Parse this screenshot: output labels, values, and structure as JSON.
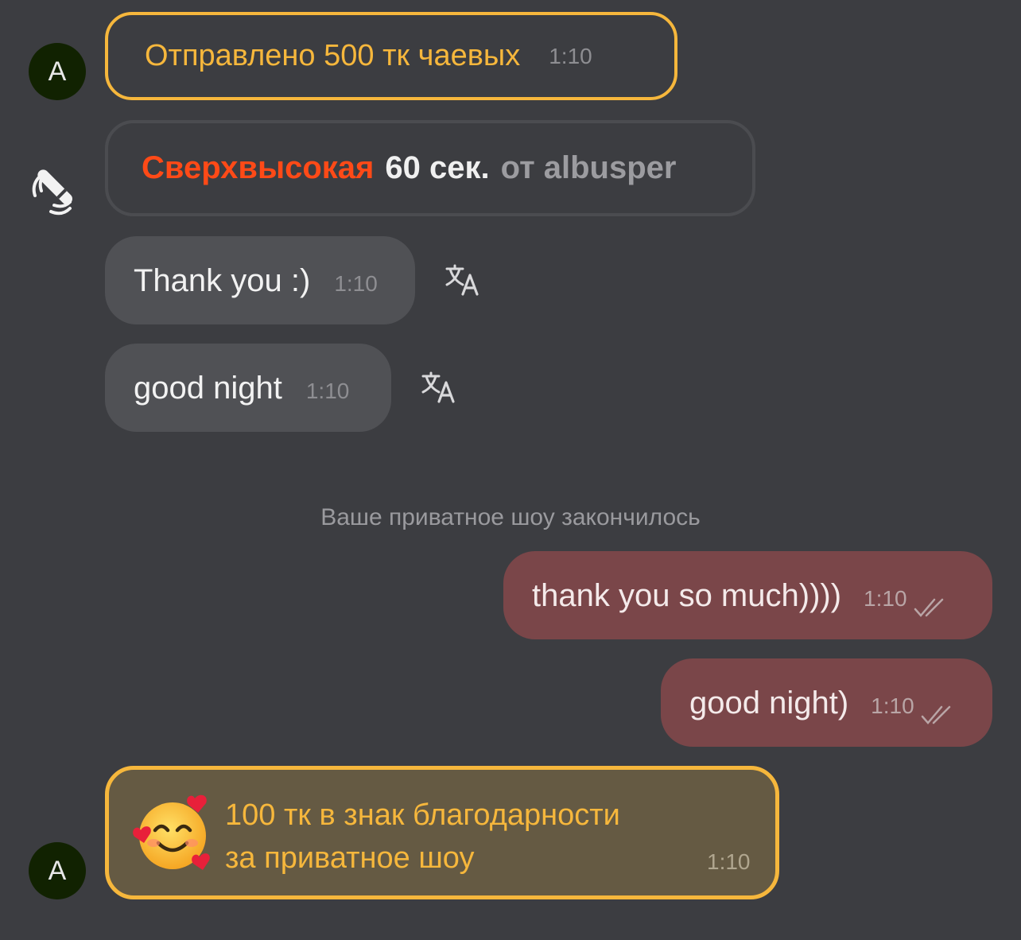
{
  "tip_message": {
    "avatar_letter": "A",
    "text": "Отправлено 500 тк чаевых",
    "time": "1:10"
  },
  "vibration_message": {
    "icon": "vibrator-icon",
    "level": "Сверхвысокая",
    "duration": "60 сек.",
    "from": "от albusper"
  },
  "incoming_messages": [
    {
      "text": "Thank you :)",
      "time": "1:10",
      "translate_icon": "translate-icon"
    },
    {
      "text": "good night",
      "time": "1:10",
      "translate_icon": "translate-icon"
    }
  ],
  "system_note": "Ваше приватное шоу закончилось",
  "outgoing_messages": [
    {
      "text": "thank you so much))))",
      "time": "1:10",
      "status": "read-checkmarks"
    },
    {
      "text": "good night)",
      "time": "1:10",
      "status": "read-checkmarks"
    }
  ],
  "gift_message": {
    "avatar_letter": "A",
    "emoji": "🥰",
    "line1": "100 тк в знак благодарности",
    "line2": "за приватное шоу",
    "time": "1:10"
  },
  "colors": {
    "background": "#3c3d41",
    "accent_gold": "#f6b73c",
    "vibration_level": "#ff4a17",
    "incoming_bubble": "#505155",
    "outgoing_bubble": "#7a4649",
    "avatar_bg": "#112201"
  }
}
